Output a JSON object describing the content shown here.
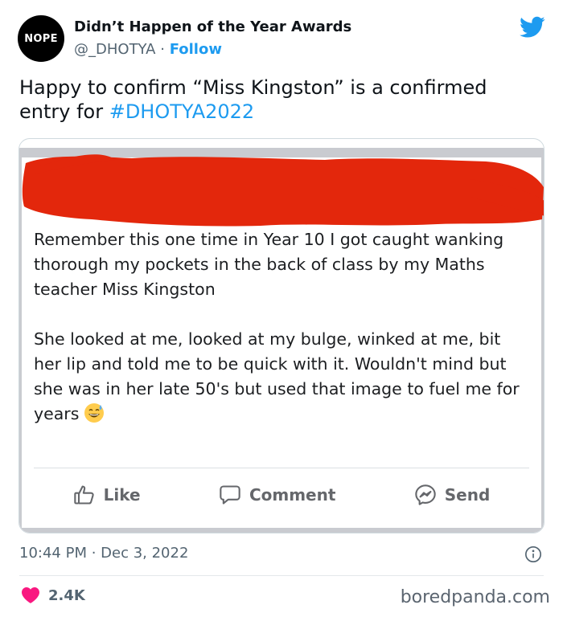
{
  "account": {
    "avatar_text": "NOPE",
    "name": "Didn’t Happen of the Year Awards",
    "handle": "@_DHOTYA",
    "separator": "·",
    "follow_label": "Follow"
  },
  "tweet": {
    "text_before": "Happy to confirm “Miss Kingston” is a confirmed entry for ",
    "hashtag": "#DHOTYA2022"
  },
  "embedded_post": {
    "paragraph1": "Remember this one time in Year 10 I got caught wanking thorough my pockets in the back of class by my Maths teacher Miss Kingston",
    "paragraph2": "She looked at me, looked at my bulge, winked at me, bit her lip and told me to be quick with it. Wouldn't mind but she was in her late 50's but used  that image to fuel me for years",
    "actions": {
      "like": "Like",
      "comment": "Comment",
      "send": "Send"
    },
    "redaction_color": "#e3270c"
  },
  "meta": {
    "timestamp": "10:44 PM · Dec 3, 2022",
    "likes": "2.4K",
    "watermark": "boredpanda.com"
  },
  "colors": {
    "twitter_blue": "#1d9bf0",
    "heart": "#f91880"
  },
  "icons": [
    "twitter-bird-icon",
    "info-icon",
    "heart-icon",
    "like-thumb-icon",
    "comment-bubble-icon",
    "messenger-icon",
    "grinning-sweat-emoji-icon"
  ]
}
